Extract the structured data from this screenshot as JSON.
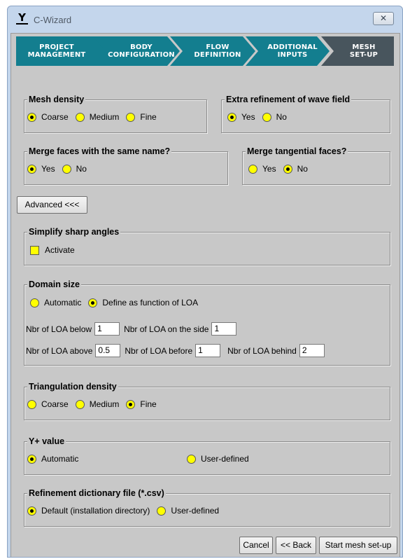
{
  "window": {
    "title": "C-Wizard",
    "close_glyph": "✕"
  },
  "steps": [
    {
      "line1": "Project",
      "line2": "Management"
    },
    {
      "line1": "Body",
      "line2": "Configuration"
    },
    {
      "line1": "Flow",
      "line2": "Definition"
    },
    {
      "line1": "Additional",
      "line2": "Inputs"
    },
    {
      "line1": "Mesh",
      "line2": "Set-up",
      "active": true
    }
  ],
  "mesh_density": {
    "title": "Mesh density",
    "options": [
      "Coarse",
      "Medium",
      "Fine"
    ],
    "selected": "Coarse"
  },
  "extra_refinement": {
    "title": "Extra refinement of wave field",
    "options": [
      "Yes",
      "No"
    ],
    "selected": "Yes"
  },
  "merge_faces": {
    "title": "Merge faces with the same name?",
    "options": [
      "Yes",
      "No"
    ],
    "selected": "Yes"
  },
  "merge_tangential": {
    "title": "Merge tangential faces?",
    "options": [
      "Yes",
      "No"
    ],
    "selected": "No"
  },
  "advanced_button": "Advanced <<<",
  "simplify": {
    "title": "Simplify sharp angles",
    "checkbox_label": "Activate",
    "checked": false
  },
  "domain_size": {
    "title": "Domain size",
    "options": [
      "Automatic",
      "Define as function of LOA"
    ],
    "selected": "Define as function of LOA",
    "below_label": "Nbr of LOA below",
    "below_value": "1",
    "side_label": "Nbr of LOA on the side",
    "side_value": "1",
    "above_label": "Nbr of LOA above",
    "above_value": "0.5",
    "before_label": "Nbr of LOA before",
    "before_value": "1",
    "behind_label": "Nbr of LOA behind",
    "behind_value": "2"
  },
  "triangulation": {
    "title": "Triangulation density",
    "options": [
      "Coarse",
      "Medium",
      "Fine"
    ],
    "selected": "Fine"
  },
  "yplus": {
    "title": "Y+ value",
    "options": [
      "Automatic",
      "User-defined"
    ],
    "selected": "Automatic"
  },
  "refinement_file": {
    "title": "Refinement dictionary file (*.csv)",
    "options": [
      "Default (installation directory)",
      "User-defined"
    ],
    "selected": "Default (installation directory)"
  },
  "buttons": {
    "cancel": "Cancel",
    "back": "<< Back",
    "start": "Start mesh set-up"
  },
  "colors": {
    "wizard_step": "#137e8f",
    "wizard_step_active": "#48555d",
    "radio_fill": "#ffff00",
    "panel_bg": "#c8c8c8"
  }
}
